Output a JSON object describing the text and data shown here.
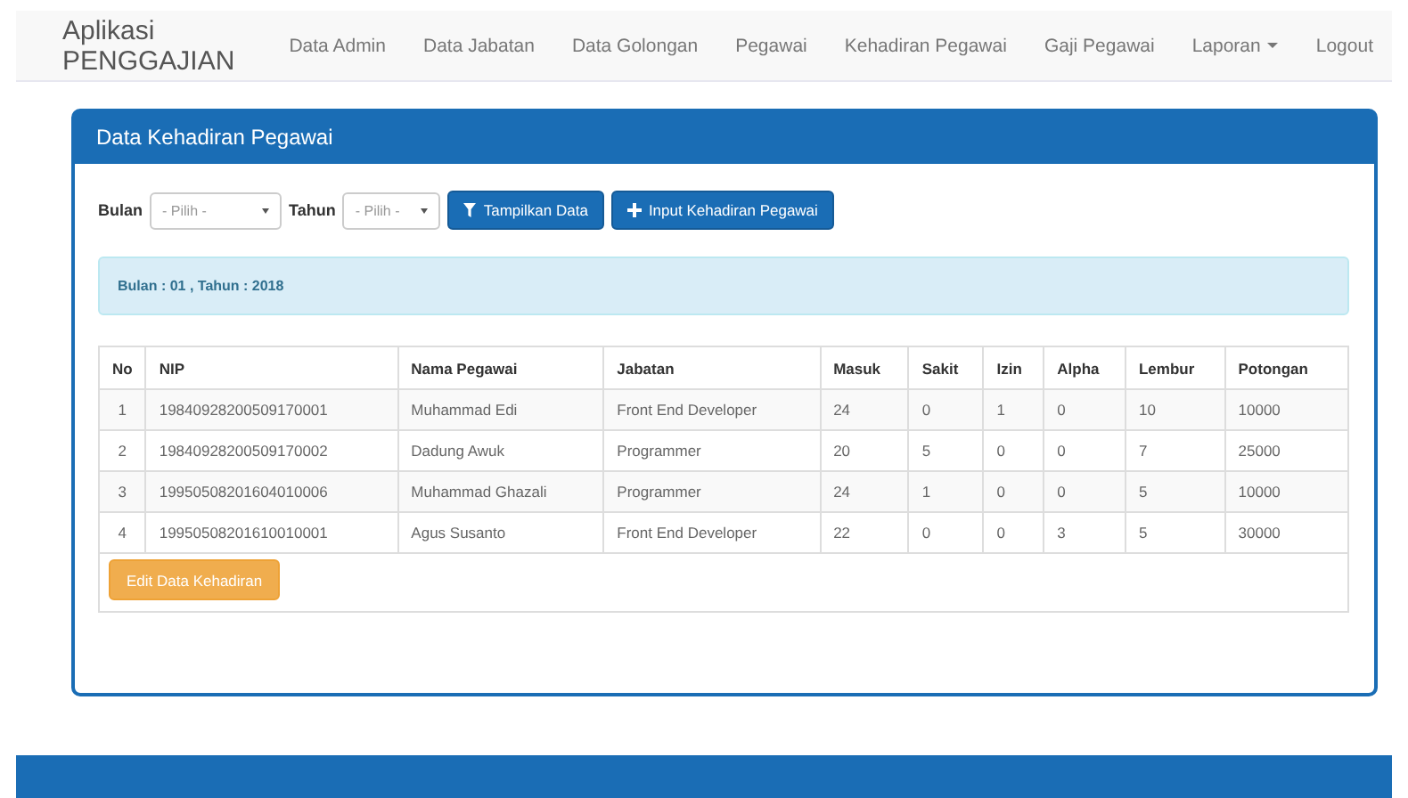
{
  "navbar": {
    "brand": "Aplikasi PENGGAJIAN",
    "items": [
      {
        "label": "Data Admin",
        "kind": "link"
      },
      {
        "label": "Data Jabatan",
        "kind": "link"
      },
      {
        "label": "Data Golongan",
        "kind": "link"
      },
      {
        "label": "Pegawai",
        "kind": "link"
      },
      {
        "label": "Kehadiran Pegawai",
        "kind": "link"
      },
      {
        "label": "Gaji Pegawai",
        "kind": "link"
      },
      {
        "label": "Laporan",
        "kind": "dropdown"
      },
      {
        "label": "Logout",
        "kind": "link"
      }
    ]
  },
  "panel": {
    "title": "Data Kehadiran Pegawai",
    "filters": [
      {
        "label": "Bulan",
        "placeholder": "- Pilih -"
      },
      {
        "label": "Tahun",
        "placeholder": "- Pilih -"
      }
    ],
    "buttons": [
      {
        "label": "Tampilkan Data",
        "kind": "filter"
      },
      {
        "label": "Input Kehadiran Pegawai",
        "kind": "add"
      }
    ],
    "alert": "Bulan : 01 , Tahun : 2018",
    "table": {
      "columns": [
        "No",
        "NIP",
        "Nama Pegawai",
        "Jabatan",
        "Masuk",
        "Sakit",
        "Izin",
        "Alpha",
        "Lembur",
        "Potongan"
      ],
      "rows": [
        [
          "1",
          "19840928200509170001",
          "Muhammad Edi",
          "Front End Developer",
          "24",
          "0",
          "1",
          "0",
          "10",
          "10000"
        ],
        [
          "2",
          "19840928200509170002",
          "Dadung Awuk",
          "Programmer",
          "20",
          "5",
          "0",
          "0",
          "7",
          "25000"
        ],
        [
          "3",
          "19950508201604010006",
          "Muhammad Ghazali",
          "Programmer",
          "24",
          "1",
          "0",
          "0",
          "5",
          "10000"
        ],
        [
          "4",
          "19950508201610010001",
          "Agus Susanto",
          "Front End Developer",
          "22",
          "0",
          "0",
          "3",
          "5",
          "30000"
        ]
      ]
    },
    "edit_button": "Edit Data Kehadiran"
  }
}
